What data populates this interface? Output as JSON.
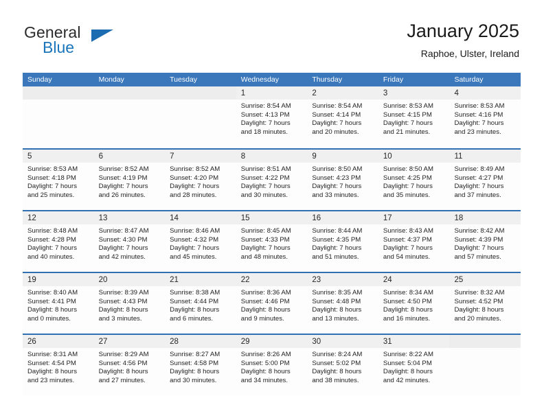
{
  "logo": {
    "word1": "General",
    "word2": "Blue",
    "triangle_color": "#1b6cb0",
    "word2_color": "#1b75bb"
  },
  "header": {
    "title": "January 2025",
    "subtitle": "Raphoe, Ulster, Ireland"
  },
  "theme": {
    "header_blue": "#3a77bb",
    "row_divider_blue": "#2f6fb2",
    "daynum_band": "#f0f0f0",
    "cell_background": "#fdfdfd",
    "text": "#1f1f1f"
  },
  "weekdays": [
    "Sunday",
    "Monday",
    "Tuesday",
    "Wednesday",
    "Thursday",
    "Friday",
    "Saturday"
  ],
  "weeks": [
    [
      {
        "day": "",
        "lines": []
      },
      {
        "day": "",
        "lines": []
      },
      {
        "day": "",
        "lines": []
      },
      {
        "day": "1",
        "lines": [
          "Sunrise: 8:54 AM",
          "Sunset: 4:13 PM",
          "Daylight: 7 hours",
          "and 18 minutes."
        ]
      },
      {
        "day": "2",
        "lines": [
          "Sunrise: 8:54 AM",
          "Sunset: 4:14 PM",
          "Daylight: 7 hours",
          "and 20 minutes."
        ]
      },
      {
        "day": "3",
        "lines": [
          "Sunrise: 8:53 AM",
          "Sunset: 4:15 PM",
          "Daylight: 7 hours",
          "and 21 minutes."
        ]
      },
      {
        "day": "4",
        "lines": [
          "Sunrise: 8:53 AM",
          "Sunset: 4:16 PM",
          "Daylight: 7 hours",
          "and 23 minutes."
        ]
      }
    ],
    [
      {
        "day": "5",
        "lines": [
          "Sunrise: 8:53 AM",
          "Sunset: 4:18 PM",
          "Daylight: 7 hours",
          "and 25 minutes."
        ]
      },
      {
        "day": "6",
        "lines": [
          "Sunrise: 8:52 AM",
          "Sunset: 4:19 PM",
          "Daylight: 7 hours",
          "and 26 minutes."
        ]
      },
      {
        "day": "7",
        "lines": [
          "Sunrise: 8:52 AM",
          "Sunset: 4:20 PM",
          "Daylight: 7 hours",
          "and 28 minutes."
        ]
      },
      {
        "day": "8",
        "lines": [
          "Sunrise: 8:51 AM",
          "Sunset: 4:22 PM",
          "Daylight: 7 hours",
          "and 30 minutes."
        ]
      },
      {
        "day": "9",
        "lines": [
          "Sunrise: 8:50 AM",
          "Sunset: 4:23 PM",
          "Daylight: 7 hours",
          "and 33 minutes."
        ]
      },
      {
        "day": "10",
        "lines": [
          "Sunrise: 8:50 AM",
          "Sunset: 4:25 PM",
          "Daylight: 7 hours",
          "and 35 minutes."
        ]
      },
      {
        "day": "11",
        "lines": [
          "Sunrise: 8:49 AM",
          "Sunset: 4:27 PM",
          "Daylight: 7 hours",
          "and 37 minutes."
        ]
      }
    ],
    [
      {
        "day": "12",
        "lines": [
          "Sunrise: 8:48 AM",
          "Sunset: 4:28 PM",
          "Daylight: 7 hours",
          "and 40 minutes."
        ]
      },
      {
        "day": "13",
        "lines": [
          "Sunrise: 8:47 AM",
          "Sunset: 4:30 PM",
          "Daylight: 7 hours",
          "and 42 minutes."
        ]
      },
      {
        "day": "14",
        "lines": [
          "Sunrise: 8:46 AM",
          "Sunset: 4:32 PM",
          "Daylight: 7 hours",
          "and 45 minutes."
        ]
      },
      {
        "day": "15",
        "lines": [
          "Sunrise: 8:45 AM",
          "Sunset: 4:33 PM",
          "Daylight: 7 hours",
          "and 48 minutes."
        ]
      },
      {
        "day": "16",
        "lines": [
          "Sunrise: 8:44 AM",
          "Sunset: 4:35 PM",
          "Daylight: 7 hours",
          "and 51 minutes."
        ]
      },
      {
        "day": "17",
        "lines": [
          "Sunrise: 8:43 AM",
          "Sunset: 4:37 PM",
          "Daylight: 7 hours",
          "and 54 minutes."
        ]
      },
      {
        "day": "18",
        "lines": [
          "Sunrise: 8:42 AM",
          "Sunset: 4:39 PM",
          "Daylight: 7 hours",
          "and 57 minutes."
        ]
      }
    ],
    [
      {
        "day": "19",
        "lines": [
          "Sunrise: 8:40 AM",
          "Sunset: 4:41 PM",
          "Daylight: 8 hours",
          "and 0 minutes."
        ]
      },
      {
        "day": "20",
        "lines": [
          "Sunrise: 8:39 AM",
          "Sunset: 4:43 PM",
          "Daylight: 8 hours",
          "and 3 minutes."
        ]
      },
      {
        "day": "21",
        "lines": [
          "Sunrise: 8:38 AM",
          "Sunset: 4:44 PM",
          "Daylight: 8 hours",
          "and 6 minutes."
        ]
      },
      {
        "day": "22",
        "lines": [
          "Sunrise: 8:36 AM",
          "Sunset: 4:46 PM",
          "Daylight: 8 hours",
          "and 9 minutes."
        ]
      },
      {
        "day": "23",
        "lines": [
          "Sunrise: 8:35 AM",
          "Sunset: 4:48 PM",
          "Daylight: 8 hours",
          "and 13 minutes."
        ]
      },
      {
        "day": "24",
        "lines": [
          "Sunrise: 8:34 AM",
          "Sunset: 4:50 PM",
          "Daylight: 8 hours",
          "and 16 minutes."
        ]
      },
      {
        "day": "25",
        "lines": [
          "Sunrise: 8:32 AM",
          "Sunset: 4:52 PM",
          "Daylight: 8 hours",
          "and 20 minutes."
        ]
      }
    ],
    [
      {
        "day": "26",
        "lines": [
          "Sunrise: 8:31 AM",
          "Sunset: 4:54 PM",
          "Daylight: 8 hours",
          "and 23 minutes."
        ]
      },
      {
        "day": "27",
        "lines": [
          "Sunrise: 8:29 AM",
          "Sunset: 4:56 PM",
          "Daylight: 8 hours",
          "and 27 minutes."
        ]
      },
      {
        "day": "28",
        "lines": [
          "Sunrise: 8:27 AM",
          "Sunset: 4:58 PM",
          "Daylight: 8 hours",
          "and 30 minutes."
        ]
      },
      {
        "day": "29",
        "lines": [
          "Sunrise: 8:26 AM",
          "Sunset: 5:00 PM",
          "Daylight: 8 hours",
          "and 34 minutes."
        ]
      },
      {
        "day": "30",
        "lines": [
          "Sunrise: 8:24 AM",
          "Sunset: 5:02 PM",
          "Daylight: 8 hours",
          "and 38 minutes."
        ]
      },
      {
        "day": "31",
        "lines": [
          "Sunrise: 8:22 AM",
          "Sunset: 5:04 PM",
          "Daylight: 8 hours",
          "and 42 minutes."
        ]
      },
      {
        "day": "",
        "lines": []
      }
    ]
  ]
}
